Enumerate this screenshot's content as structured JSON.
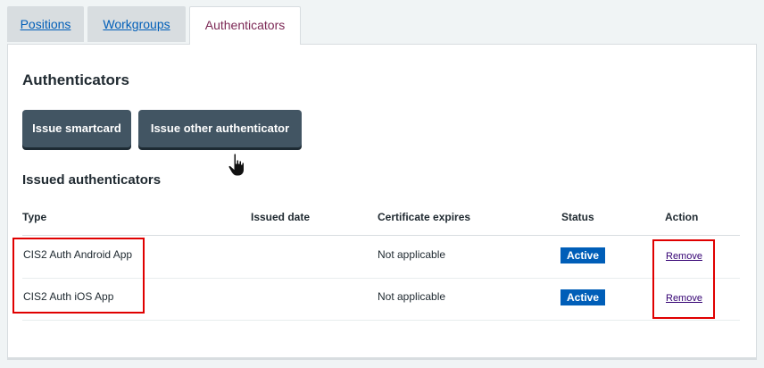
{
  "tabs": [
    {
      "label": "Positions"
    },
    {
      "label": "Workgroups"
    },
    {
      "label": "Authenticators"
    }
  ],
  "section_title": "Authenticators",
  "buttons": {
    "issue_smartcard": "Issue smartcard",
    "issue_other": "Issue other authenticator"
  },
  "issued_title": "Issued authenticators",
  "table": {
    "headers": [
      "Type",
      "Issued date",
      "Certificate expires",
      "Status",
      "Action"
    ],
    "rows": [
      {
        "type": "CIS2 Auth Android App",
        "issued": "",
        "expires": "Not applicable",
        "status": "Active",
        "action": "Remove"
      },
      {
        "type": "CIS2 Auth iOS App",
        "issued": "",
        "expires": "Not applicable",
        "status": "Active",
        "action": "Remove"
      }
    ]
  },
  "colors": {
    "link": "#005eb8",
    "button": "#425563",
    "badge": "#005eb8",
    "highlight": "#e00000"
  }
}
